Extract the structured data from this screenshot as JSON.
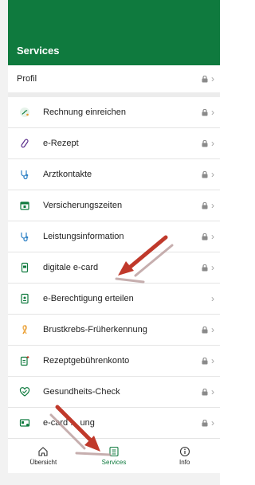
{
  "header": {
    "title": "Services"
  },
  "profil": {
    "label": "Profil",
    "locked": true
  },
  "services": [
    {
      "label": "Rechnung einreichen",
      "icon": "invoice-icon",
      "locked": true
    },
    {
      "label": "e-Rezept",
      "icon": "pill-icon",
      "locked": true
    },
    {
      "label": "Arztkontakte",
      "icon": "stethoscope-icon",
      "locked": true
    },
    {
      "label": "Versicherungszeiten",
      "icon": "calendar-icon",
      "locked": true
    },
    {
      "label": "Leistungsinformation",
      "icon": "stethoscope-icon",
      "locked": true
    },
    {
      "label": "digitale e-card",
      "icon": "phone-card-icon",
      "locked": true
    },
    {
      "label": "e-Berechtigung erteilen",
      "icon": "document-icon",
      "locked": false
    },
    {
      "label": "Brustkrebs-Früherkennung",
      "icon": "ribbon-icon",
      "locked": true
    },
    {
      "label": "Rezeptgebührenkonto",
      "icon": "document-plus-icon",
      "locked": true
    },
    {
      "label": "Gesundheits-Check",
      "icon": "heart-check-icon",
      "locked": true
    },
    {
      "label": "e-card ... ung",
      "icon": "card-icon",
      "locked": true
    }
  ],
  "bottom_nav": [
    {
      "label": "Übersicht",
      "icon": "home-icon",
      "active": false
    },
    {
      "label": "Services",
      "icon": "list-icon",
      "active": true
    },
    {
      "label": "Info",
      "icon": "info-icon",
      "active": false
    }
  ],
  "colors": {
    "brand": "#0f7a3e",
    "arrow": "#c0392b",
    "icon_green": "#0f7a3e",
    "icon_orange": "#e89a2c"
  }
}
